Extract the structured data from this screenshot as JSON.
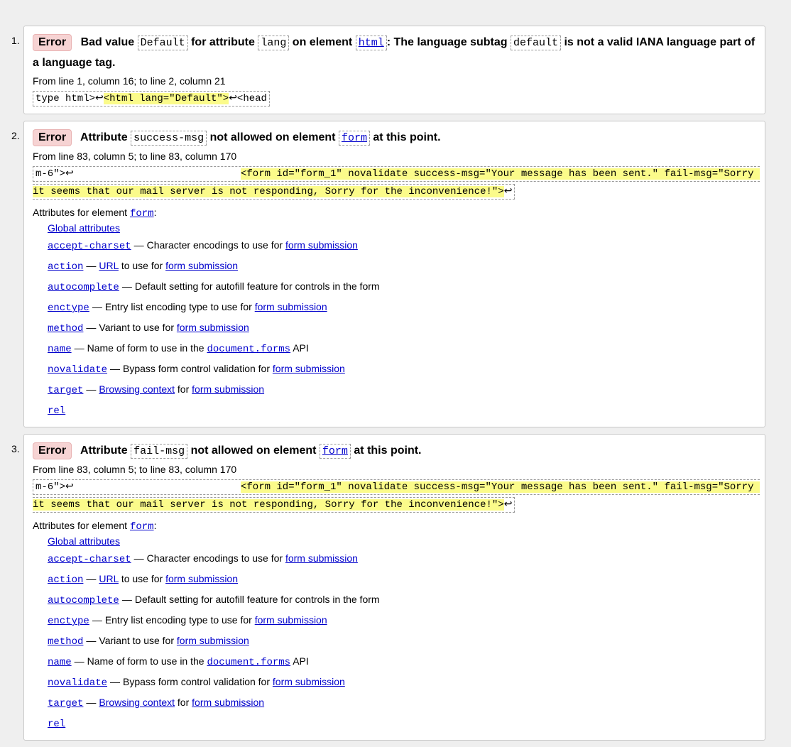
{
  "messages": [
    {
      "num": "1.",
      "badge": "Error",
      "h1": "Bad value",
      "c1": "Default",
      "h2": "for attribute",
      "c2": "lang",
      "h3": "on element",
      "c3": "html",
      "h4": ": The language subtag",
      "c4": "default",
      "h5": "is not a valid IANA language part of a language tag.",
      "loc": "From line 1, column 16; to line 2, column 21",
      "pre": "type html>↩",
      "hl": "<html lang=\"Default\">",
      "post": "↩<head"
    },
    {
      "num": "2.",
      "badge": "Error",
      "h1": "Attribute",
      "c1": "success-msg",
      "h2": "not allowed on element",
      "c2": "form",
      "h3": "at this point.",
      "loc": "From line 83, column 5; to line 83, column 170",
      "pre": "m-6\">↩                            ",
      "hl": "<form id=\"form_1\" novalidate success-msg=\"Your message has been sent.\" fail-msg=\"Sorry it seems that our mail server is not responding, Sorry for the inconvenience!\">",
      "post": "↩",
      "attrs_title": "Attributes for element",
      "attrs_el": "form"
    },
    {
      "num": "3.",
      "badge": "Error",
      "h1": "Attribute",
      "c1": "fail-msg",
      "h2": "not allowed on element",
      "c2": "form",
      "h3": "at this point.",
      "loc": "From line 83, column 5; to line 83, column 170",
      "pre": "m-6\">↩                            ",
      "hl": "<form id=\"form_1\" novalidate success-msg=\"Your message has been sent.\" fail-msg=\"Sorry it seems that our mail server is not responding, Sorry for the inconvenience!\">",
      "post": "↩",
      "attrs_title": "Attributes for element",
      "attrs_el": "form"
    }
  ],
  "attrs": {
    "global": "Global attributes",
    "accept_charset": {
      "name": "accept-charset",
      "desc": "Character encodings to use for",
      "link": "form submission"
    },
    "action": {
      "name": "action",
      "link1": "URL",
      "desc": "to use for",
      "link2": "form submission"
    },
    "autocomplete": {
      "name": "autocomplete",
      "desc": "Default setting for autofill feature for controls in the form"
    },
    "enctype": {
      "name": "enctype",
      "desc": "Entry list encoding type to use for",
      "link": "form submission"
    },
    "method": {
      "name": "method",
      "desc": "Variant to use for",
      "link": "form submission"
    },
    "name": {
      "name": "name",
      "desc": "Name of form to use in the",
      "code": "document.forms",
      "desc2": "API"
    },
    "novalidate": {
      "name": "novalidate",
      "desc": "Bypass form control validation for",
      "link": "form submission"
    },
    "target": {
      "name": "target",
      "link1": "Browsing context",
      "desc": "for",
      "link2": "form submission"
    },
    "rel": {
      "name": "rel"
    },
    "dash": "—",
    "colon": ":"
  }
}
